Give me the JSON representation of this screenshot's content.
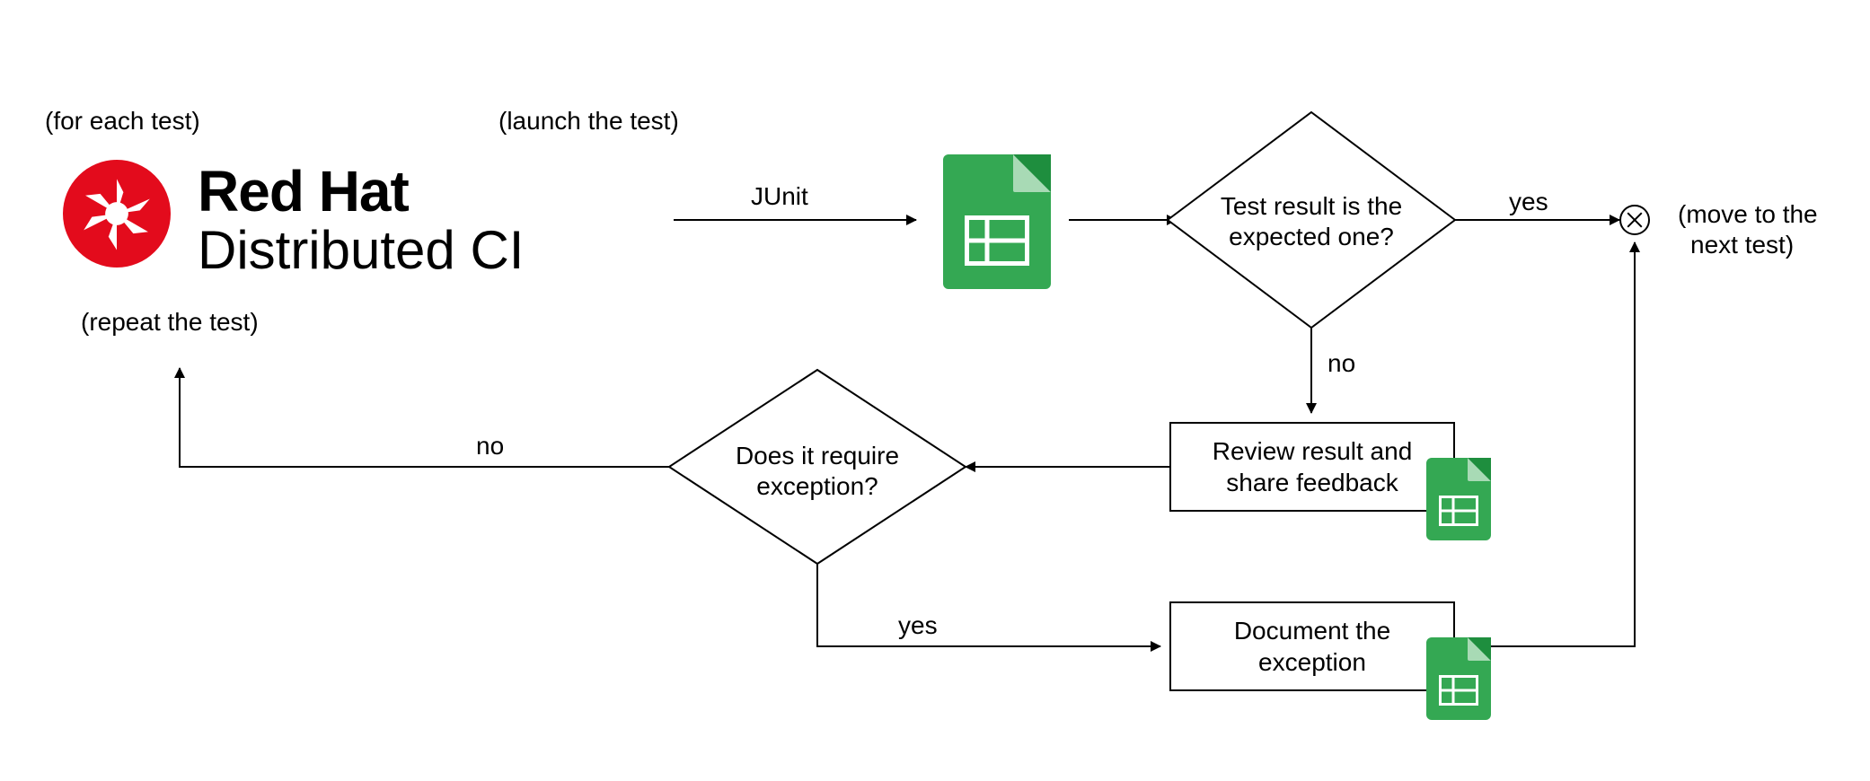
{
  "annotations": {
    "for_each_test": "(for each test)",
    "launch_test": "(launch the test)",
    "repeat_test": "(repeat the test)",
    "move_next_line1": "(move to the",
    "move_next_line2": "next test)"
  },
  "branding": {
    "redhat": "Red Hat",
    "dci": "Distributed CI"
  },
  "edges": {
    "junit": "JUnit",
    "yes_top": "yes",
    "no_top": "no",
    "no_left": "no",
    "yes_bottom": "yes"
  },
  "decisions": {
    "expected_line1": "Test result is the",
    "expected_line2": "expected one?",
    "exception_line1": "Does it require",
    "exception_line2": "exception?"
  },
  "processes": {
    "review_line1": "Review result and",
    "review_line2": "share feedback",
    "document_line1": "Document the",
    "document_line2": "exception"
  }
}
